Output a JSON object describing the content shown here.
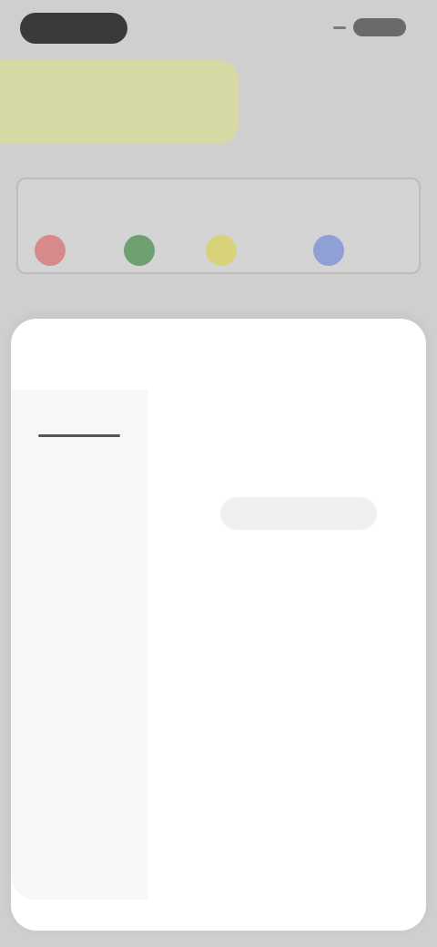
{
  "banner": {
    "text": ""
  },
  "palette": {
    "label": "",
    "colors": [
      "#d88a8a",
      "#6fa072",
      "#d9d27c",
      "#8fa0d6"
    ]
  },
  "sheet": {
    "title": "",
    "sidebar": [
      {
        "label": ""
      },
      {
        "label": ""
      },
      {
        "label": ""
      },
      {
        "label": ""
      },
      {
        "label": ""
      },
      {
        "label": ""
      },
      {
        "label": ""
      },
      {
        "label": ""
      },
      {
        "label": ""
      }
    ],
    "content": {
      "description": "",
      "button_label": "",
      "note": ""
    }
  },
  "colors": {
    "background": "#cfcfcf",
    "banner": "#d7d9a5",
    "sheet": "#ffffff"
  }
}
